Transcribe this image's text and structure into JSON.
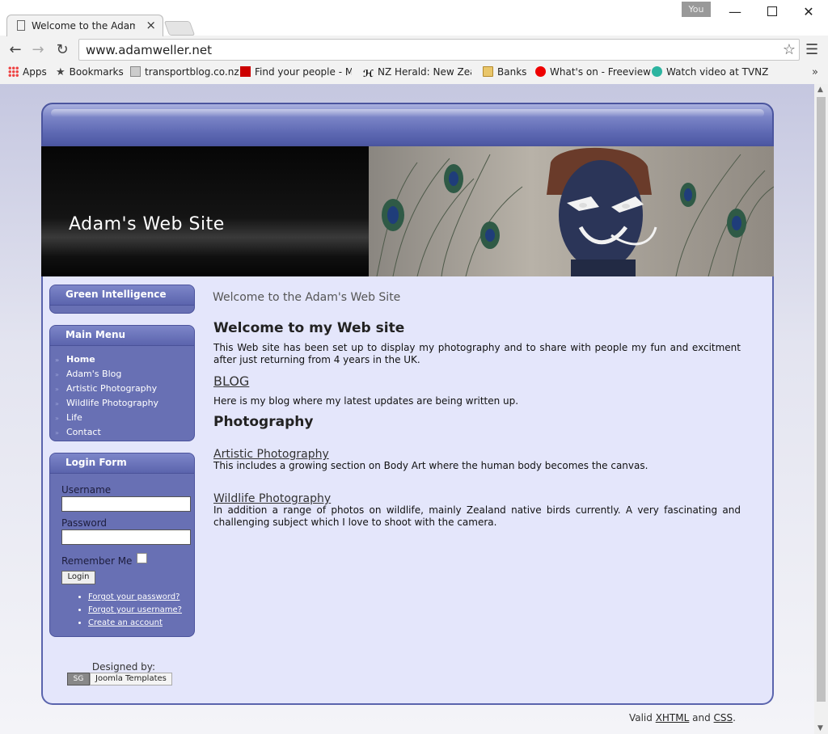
{
  "browser": {
    "tab_title": "Welcome to the Adam's W",
    "user_badge": "You",
    "url": "www.adamweller.net",
    "bookmarks": [
      {
        "label": "Apps"
      },
      {
        "label": "Bookmarks"
      },
      {
        "label": "transportblog.co.nz"
      },
      {
        "label": "Find your people - Me"
      },
      {
        "label": "NZ Herald: New Zeala"
      },
      {
        "label": "Banks"
      },
      {
        "label": "What's on - Freeview"
      },
      {
        "label": "Watch video at TVNZ"
      }
    ]
  },
  "site": {
    "banner_title": "Adam's Web Site",
    "modules": {
      "green": {
        "title": "Green Intelligence"
      },
      "main_menu": {
        "title": "Main Menu",
        "items": [
          {
            "label": "Home"
          },
          {
            "label": "Adam's Blog"
          },
          {
            "label": "Artistic Photography"
          },
          {
            "label": "Wildlife Photography"
          },
          {
            "label": "Life"
          },
          {
            "label": "Contact"
          }
        ]
      },
      "login": {
        "title": "Login Form",
        "username_label": "Username",
        "password_label": "Password",
        "remember_label": "Remember Me",
        "button": "Login",
        "links": [
          "Forgot your password?",
          "Forgot your username?",
          "Create an account"
        ]
      }
    },
    "designed_by": "Designed by:",
    "designed_badge_logo": "SG",
    "designed_badge_text": "Joomla Templates",
    "main": {
      "page_heading": "Welcome to the Adam's Web Site",
      "heading": "Welcome to my Web site",
      "intro": "This Web site has been set up to display my photography and to share with people my fun and excitment after just returning from 4 years in the UK.",
      "blog_link": "BLOG",
      "blog_text": "Here is my blog where my latest updates are being written up.",
      "photo_heading": "Photography",
      "art_link": "Artistic Photography",
      "art_text": "This includes a growing section on Body Art where the human body becomes the canvas.",
      "wild_link": "Wildlife Photography",
      "wild_text": "In addition a range of photos on wildlife, mainly Zealand native birds currently. A very fascinating and challenging subject which I love to shoot with the camera."
    },
    "footer": {
      "valid_prefix": "Valid",
      "xhtml": "XHTML",
      "and": "and",
      "css": "CSS",
      "suffix": "."
    }
  }
}
